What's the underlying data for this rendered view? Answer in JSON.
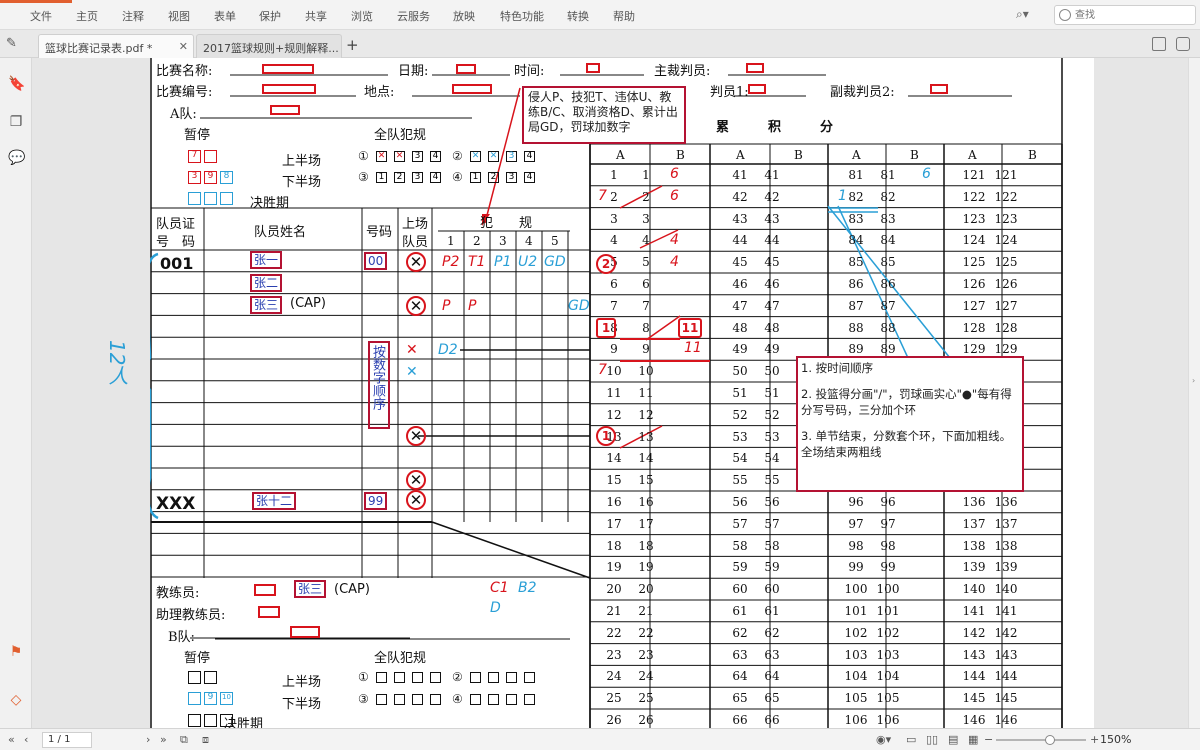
{
  "menu": {
    "items": [
      "文件",
      "主页",
      "注释",
      "视图",
      "表单",
      "保护",
      "共享",
      "浏览",
      "云服务",
      "放映",
      "特色功能",
      "转换",
      "帮助"
    ],
    "search_placeholder": "查找"
  },
  "tabs": [
    {
      "label": "篮球比赛记录表.pdf *",
      "active": true
    },
    {
      "label": "2017篮球规则+规则解释...",
      "active": false
    }
  ],
  "sheet": {
    "labels": {
      "match_name": "比赛名称:",
      "date": "日期:",
      "time": "时间:",
      "chief_referee": "主裁判员:",
      "match_no": "比赛编号:",
      "place": "地点:",
      "umpire1": "判员1:",
      "umpire2": "副裁判员2:",
      "team_a": "A队:",
      "team_b": "B队:",
      "timeout": "暂停",
      "team_foul": "全队犯规",
      "first_half": "上半场",
      "second_half": "下半场",
      "overtime": "决胜期",
      "running_score": "累　　　积　　　分",
      "player_license": "队员证",
      "license_no": "号　码",
      "player_name": "队员姓名",
      "number": "号码",
      "on_court": "上场",
      "on_court2": "队员",
      "fouls": "犯　　规",
      "coach": "教练员:",
      "asst_coach": "助理教练员:",
      "col_a": "A",
      "col_b": "B",
      "q1": "①",
      "q2": "②",
      "q3": "③",
      "q4": "④",
      "foul_cols": [
        "1",
        "2",
        "3",
        "4",
        "5"
      ],
      "foul_box_nums": [
        "3",
        "4",
        "3",
        "4"
      ]
    },
    "players": [
      {
        "license": "001",
        "name": "张一",
        "number": "00",
        "fouls": [
          "P2",
          "T1",
          "P1",
          "U2",
          "GD"
        ]
      },
      {
        "license": "",
        "name": "张二",
        "number": "",
        "fouls": []
      },
      {
        "license": "",
        "name": "张三",
        "cap": "(CAP)",
        "number": "",
        "fouls": [
          "P",
          "P"
        ],
        "extra": "GD"
      },
      {
        "license": "XXX",
        "name": "张十二",
        "number": "99",
        "fouls": []
      }
    ],
    "row_count_note": "12人",
    "number_order_note": "按数字顺序",
    "coach_name": "张三",
    "coach_cap": "(CAP)",
    "coach_fouls": [
      "C1",
      "B2",
      "D"
    ],
    "row_d2": "D2",
    "timeout_marks": {
      "first_half": [
        "7"
      ],
      "second_half": [
        "3",
        "9",
        "8"
      ],
      "b_second_half": [
        "9",
        "10"
      ]
    },
    "score_marks": {
      "a_col": [
        {
          "row": 2,
          "v": "7"
        },
        {
          "row": 5,
          "v": "2"
        },
        {
          "row": 8,
          "v": "1"
        },
        {
          "row": 10,
          "v": "7"
        },
        {
          "row": 13,
          "v": "1"
        }
      ],
      "b_col": [
        {
          "row": 1,
          "v": "6"
        },
        {
          "row": 2,
          "v": "6"
        },
        {
          "row": 4,
          "v": "4"
        },
        {
          "row": 5,
          "v": "4"
        },
        {
          "row": 8,
          "v": "11"
        },
        {
          "row": 9,
          "v": "11"
        }
      ],
      "third_block": [
        {
          "row": 1,
          "v": "6"
        },
        {
          "row": 2,
          "v": "1"
        }
      ]
    }
  },
  "callout_top": "侵人P、技犯T、违体U、教练B/C、取消资格D、累计出局GD，罚球加数字",
  "callout_notes": [
    "1. 按时间顺序",
    "2. 投篮得分画\"/\"，罚球画实心\"●\"每有得分写号码，三分加个环",
    "3. 单节结束，分数套个环，下面加粗线。全场结束两粗线"
  ],
  "status": {
    "page_indicator": "1 / 1",
    "zoom": "150%"
  }
}
